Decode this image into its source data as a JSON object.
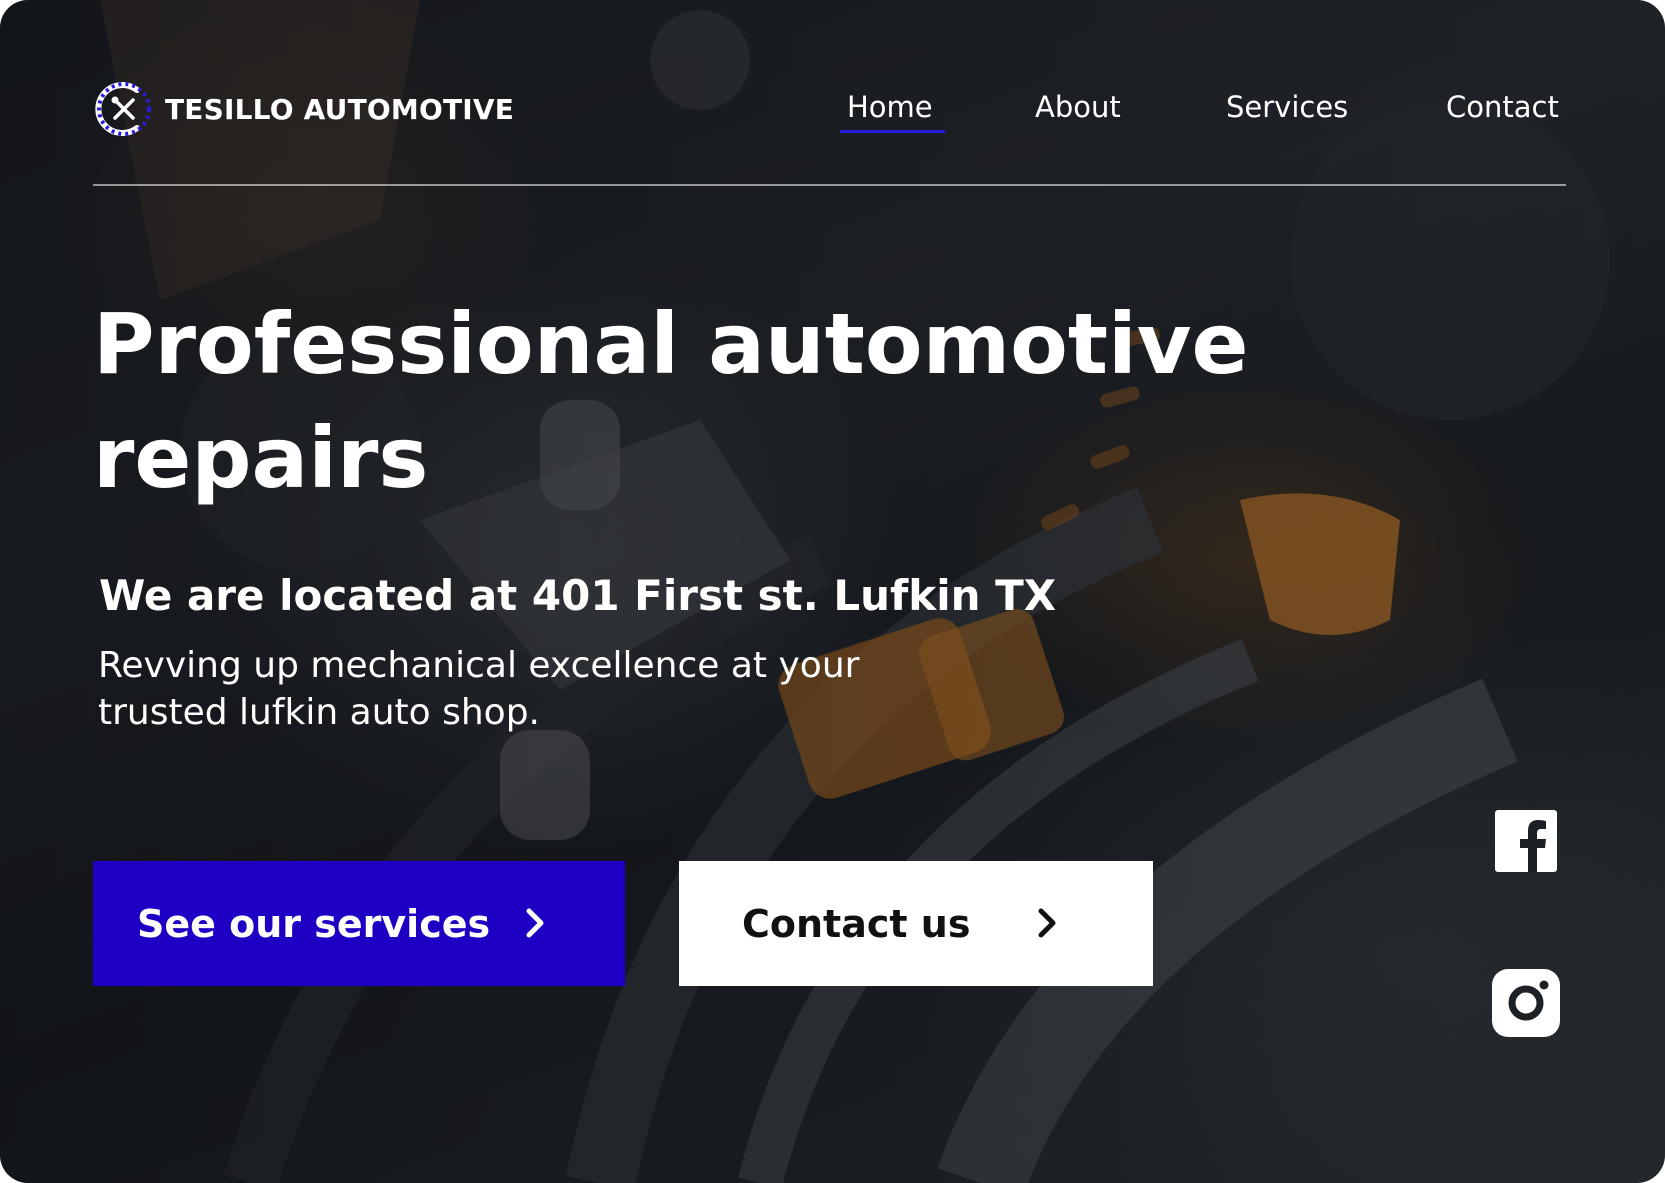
{
  "brand": {
    "name": "TESILLO AUTOMOTIVE",
    "logo_icon": "wrench-screwdriver-gear-icon",
    "accent_color": "#1e00c4"
  },
  "nav": {
    "items": [
      {
        "label": "Home",
        "active": true
      },
      {
        "label": "About",
        "active": false
      },
      {
        "label": "Services",
        "active": false
      },
      {
        "label": "Contact",
        "active": false
      }
    ],
    "active_underline_color": "#2a1adf"
  },
  "hero": {
    "headline": "Professional automotive repairs",
    "location": "We are located at 401 First st. Lufkin TX",
    "tagline": "Revving up mechanical excellence at your trusted lufkin auto shop.",
    "background": "engine-closeup-photo"
  },
  "buttons": {
    "primary": {
      "label": "See our services",
      "icon": "chevron-right-icon",
      "color": "#1e00c4"
    },
    "secondary": {
      "label": "Contact us",
      "icon": "chevron-right-icon",
      "color": "#ffffff"
    }
  },
  "social": [
    {
      "icon": "facebook-icon"
    },
    {
      "icon": "instagram-icon"
    }
  ]
}
